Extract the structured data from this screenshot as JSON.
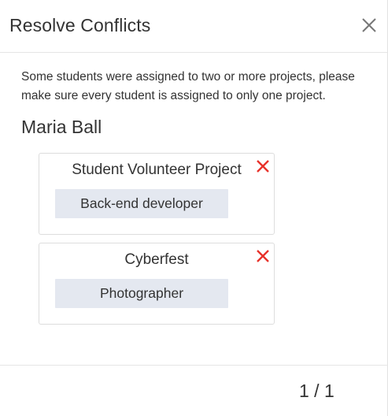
{
  "dialog": {
    "title": "Resolve Conflicts",
    "close_icon": "close-icon"
  },
  "message": "Some students were assigned to two or more projects, please make sure every student is assigned to only one project.",
  "student": {
    "name": "Maria Ball",
    "assignments": [
      {
        "project": "Student Volunteer Project",
        "role": "Back-end developer",
        "remove_icon": "remove-icon"
      },
      {
        "project": "Cyberfest",
        "role": "Photographer",
        "remove_icon": "remove-icon"
      }
    ]
  },
  "pager": {
    "text": "1 / 1"
  },
  "colors": {
    "remove_icon": "#e8322b",
    "role_chip_bg": "#e4e8f0",
    "close_icon": "#777777"
  }
}
